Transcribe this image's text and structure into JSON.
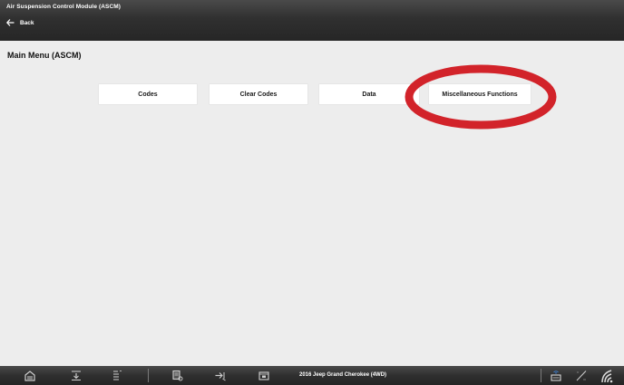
{
  "header": {
    "title": "Air Suspension Control Module (ASCM)",
    "back_label": "Back"
  },
  "main": {
    "heading": "Main Menu (ASCM)",
    "buttons": [
      {
        "label": "Codes"
      },
      {
        "label": "Clear Codes"
      },
      {
        "label": "Data"
      },
      {
        "label": "Miscellaneous Functions"
      }
    ],
    "highlight_color": "#d2232a"
  },
  "footer": {
    "vehicle": "2016 Jeep Grand Cherokee (4WD)",
    "icons": [
      "home-icon",
      "download-icon",
      "list-icon",
      "report-icon",
      "export-icon",
      "folder-icon",
      "connection-icon",
      "brightness-icon",
      "signal-icon"
    ]
  }
}
